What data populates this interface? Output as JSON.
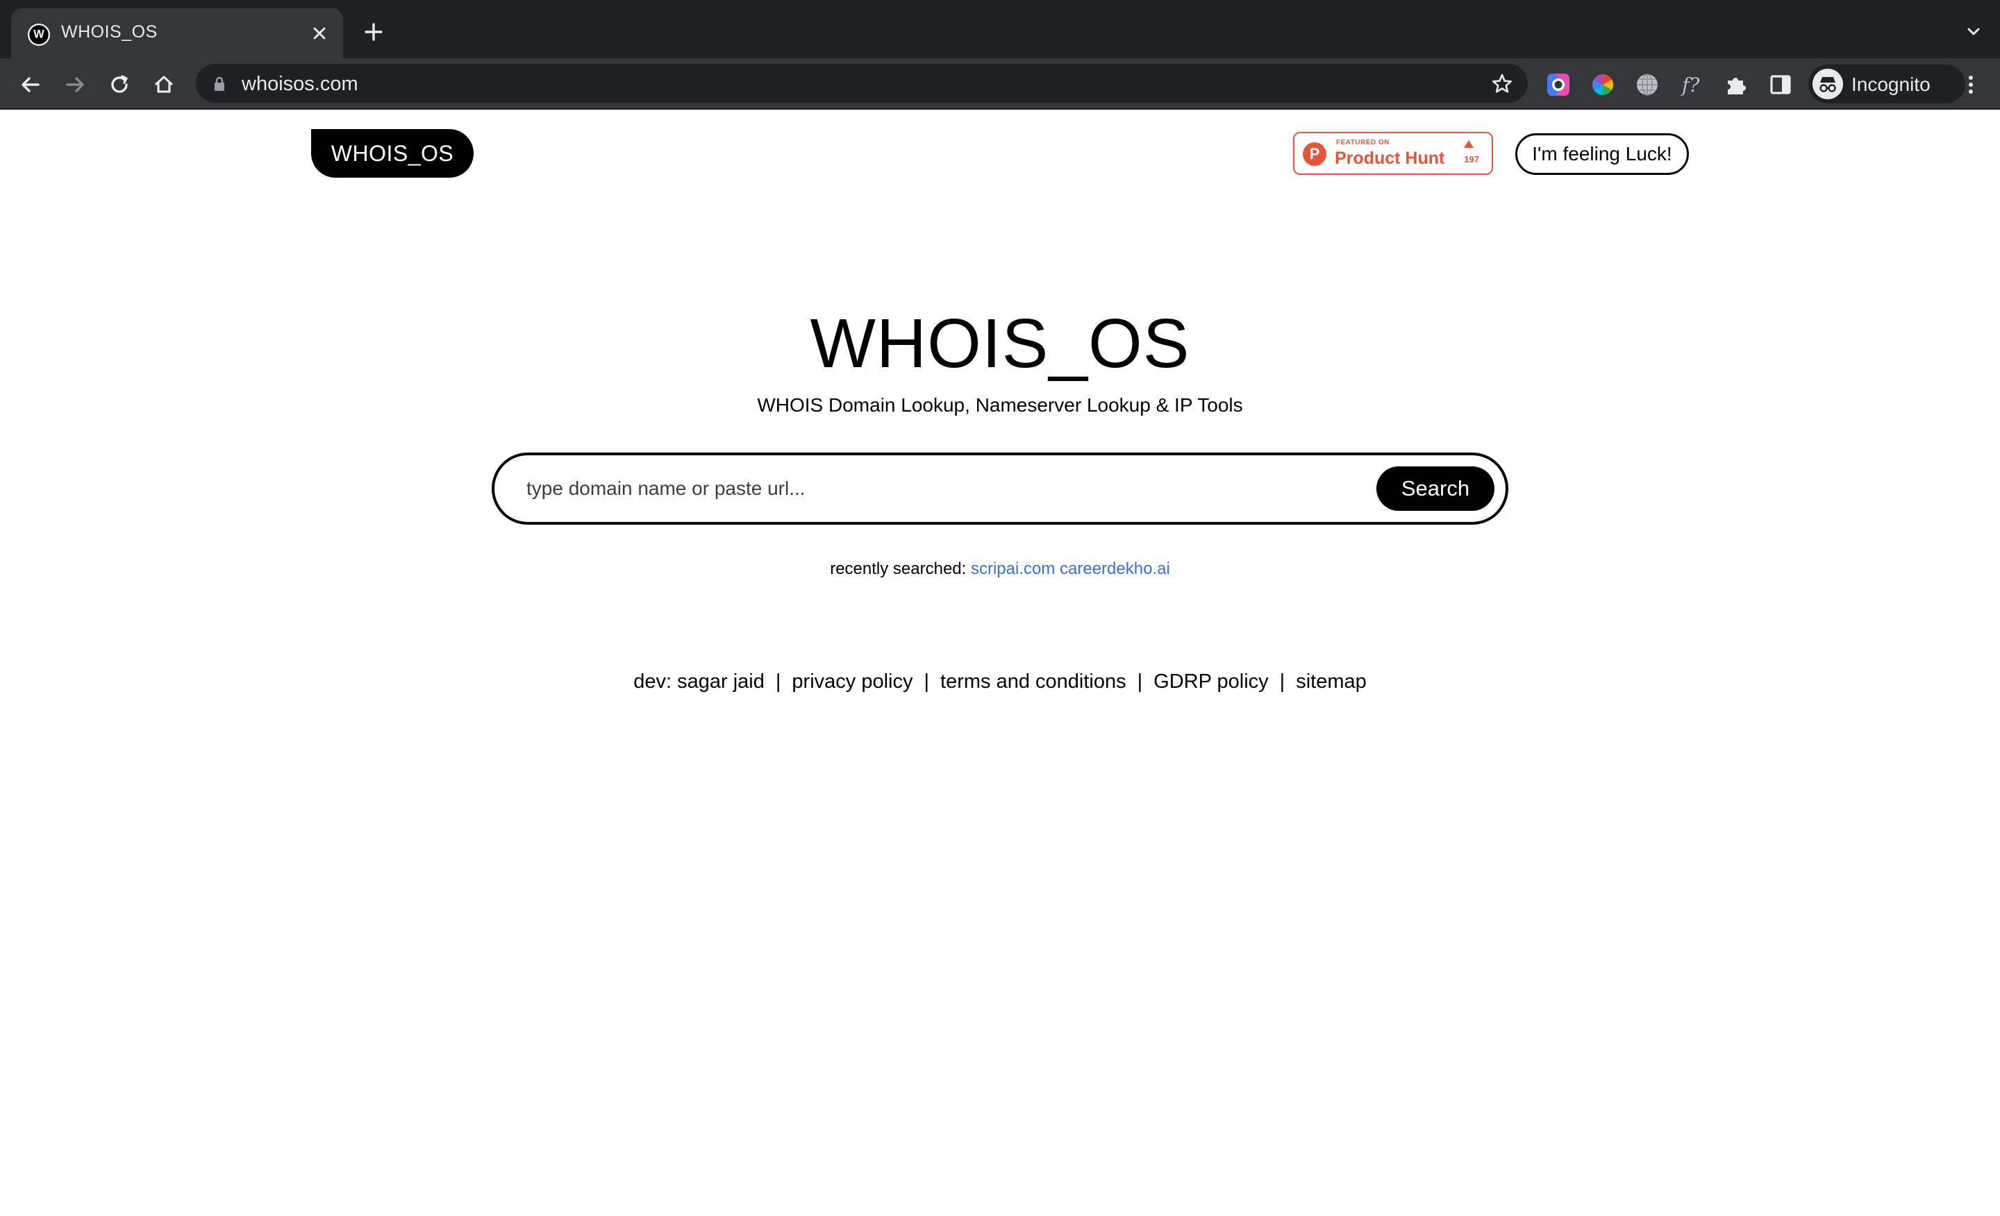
{
  "browser": {
    "tab": {
      "favicon_letter": "W",
      "title": "WHOIS_OS"
    },
    "url": "whoisos.com",
    "profile_label": "Incognito",
    "icons": [
      "close-icon",
      "plus-icon",
      "chevron-down-icon",
      "back-icon",
      "forward-icon",
      "reload-icon",
      "home-icon",
      "lock-icon",
      "star-icon",
      "extension-color-icon",
      "extension-palette-icon",
      "extension-globe-icon",
      "extension-font-icon",
      "puzzle-icon",
      "side-panel-icon",
      "incognito-icon",
      "kebab-menu-icon"
    ]
  },
  "header": {
    "logo": "WHOIS_OS",
    "product_hunt": {
      "featured": "FEATURED ON",
      "name": "Product Hunt",
      "logo_letter": "P",
      "votes": "197"
    },
    "luck_button": "I'm feeling Luck!"
  },
  "hero": {
    "title": "WHOIS_OS",
    "subtitle": "WHOIS Domain Lookup, Nameserver Lookup & IP Tools"
  },
  "search": {
    "placeholder": "type domain name or paste url...",
    "value": "",
    "button": "Search"
  },
  "recent": {
    "label": "recently searched:",
    "items": [
      "scripai.com",
      "careerdekho.ai"
    ]
  },
  "footer": {
    "links": [
      "dev: sagar jaid",
      "privacy policy",
      "terms and conditions",
      "GDRP policy",
      "sitemap"
    ],
    "separator": "|"
  },
  "colors": {
    "chrome_dark": "#202124",
    "chrome_toolbar": "#35363a",
    "product_hunt": "#e0573b",
    "link_blue": "#3b6fd6"
  }
}
